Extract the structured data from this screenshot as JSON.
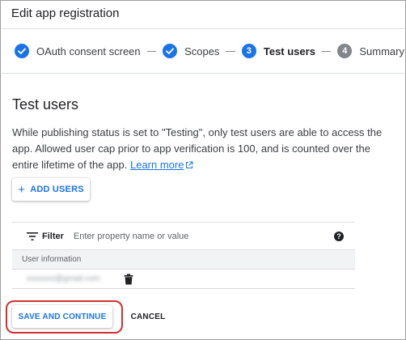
{
  "window": {
    "title": "Edit app registration"
  },
  "stepper": {
    "steps": [
      {
        "label": "OAuth consent screen",
        "state": "done",
        "marker": ""
      },
      {
        "label": "Scopes",
        "state": "done",
        "marker": ""
      },
      {
        "label": "Test users",
        "state": "active",
        "marker": "3"
      },
      {
        "label": "Summary",
        "state": "pending",
        "marker": "4"
      }
    ]
  },
  "section": {
    "title": "Test users",
    "description": "While publishing status is set to \"Testing\", only test users are able to access the app. Allowed user cap prior to app verification is 100, and is counted over the entire lifetime of the app.",
    "learn_more": "Learn more"
  },
  "add_users_button": "ADD USERS",
  "filter": {
    "label": "Filter",
    "placeholder": "Enter property name or value",
    "help": "?"
  },
  "table": {
    "header": "User information",
    "rows": [
      {
        "email": "xxxxxxx@gmail.com"
      }
    ]
  },
  "actions": {
    "save": "SAVE AND CONTINUE",
    "cancel": "CANCEL"
  },
  "colors": {
    "accent": "#1a73e8",
    "highlight": "#d32f2f",
    "pending": "#80868b"
  }
}
